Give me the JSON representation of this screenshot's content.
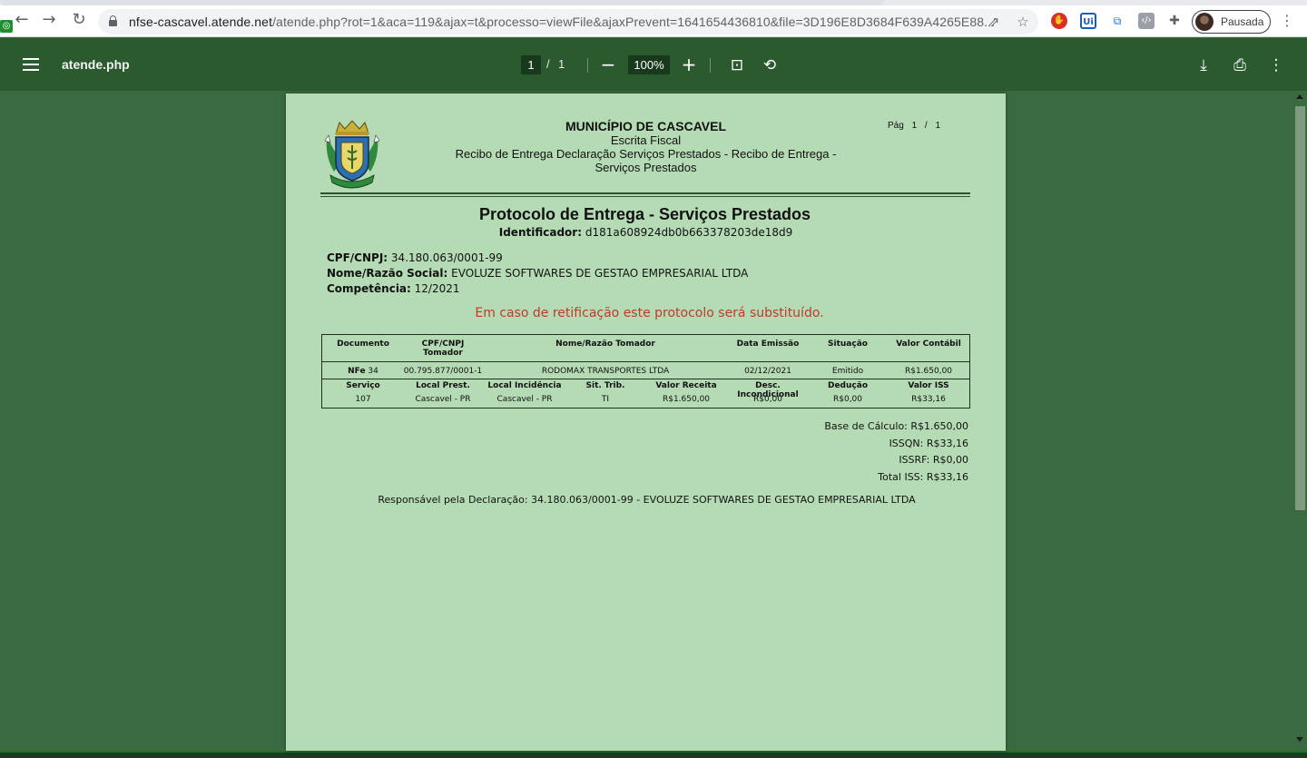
{
  "browser": {
    "url_host": "nfse-cascavel.atende.net",
    "url_rest": "/atende.php?rot=1&aca=119&ajax=t&processo=viewFile&ajaxPrevent=1641654436810&file=3D196E8D3684F639A4265E88...",
    "profile_label": "Pausada"
  },
  "viewer": {
    "title": "atende.php",
    "page_current": "1",
    "page_sep": "/",
    "page_total": "1",
    "zoom": "100%"
  },
  "doc": {
    "municipality": "MUNICÍPIO DE CASCAVEL",
    "dept": "Escrita Fiscal",
    "receipt_line1": "Recibo de Entrega Declaração Serviços Prestados - Recibo de Entrega -",
    "receipt_line2": "Serviços Prestados",
    "pag_label": "Pág   1  /  1",
    "title": "Protocolo de Entrega - Serviços Prestados",
    "identifier_label": "Identificador:",
    "identifier_value": "d181a608924db0b663378203de18d9",
    "cpf_label": "CPF/CNPJ:",
    "cpf_value": "34.180.063/0001-99",
    "nome_label": "Nome/Razão Social:",
    "nome_value": "EVOLUZE SOFTWARES DE GESTAO EMPRESARIAL LTDA",
    "comp_label": "Competência:",
    "comp_value": "12/2021",
    "warning": "Em caso de retificação este protocolo será substituído.",
    "table": {
      "h1": {
        "documento": "Documento",
        "cpf_tomador_1": "CPF/CNPJ",
        "cpf_tomador_2": "Tomador",
        "nome_tomador": "Nome/Razão Tomador",
        "data_emissao": "Data Emissão",
        "situacao": "Situação",
        "valor_contabil": "Valor Contábil"
      },
      "d1": {
        "doc_type": "NFe",
        "doc_num": "34",
        "cpf": "00.795.877/0001-1",
        "nome": "RODOMAX TRANSPORTES LTDA",
        "data": "02/12/2021",
        "situacao": "Emitido",
        "valor": "R$1.650,00"
      },
      "h2": {
        "servico": "Serviço",
        "local_prest": "Local Prest.",
        "local_incid": "Local Incidência",
        "sit_trib": "Sit. Trib.",
        "valor_receita": "Valor Receita",
        "desc_incond": "Desc. Incondicional",
        "deducao": "Dedução",
        "valor_iss": "Valor ISS"
      },
      "d2": {
        "servico": "107",
        "local_prest": "Cascavel - PR",
        "local_incid": "Cascavel - PR",
        "sit_trib": "TI",
        "valor_receita": "R$1.650,00",
        "desc_incond": "R$0,00",
        "deducao": "R$0,00",
        "valor_iss": "R$33,16"
      }
    },
    "totals": {
      "base": "Base de Cálculo: R$1.650,00",
      "issqn": "ISSQN: R$33,16",
      "issrf": "ISSRF: R$0,00",
      "total": "Total ISS: R$33,16"
    },
    "responsavel": "Responsável pela Declaração: 34.180.063/0001-99 - EVOLUZE SOFTWARES DE GESTAO EMPRESARIAL LTDA"
  }
}
